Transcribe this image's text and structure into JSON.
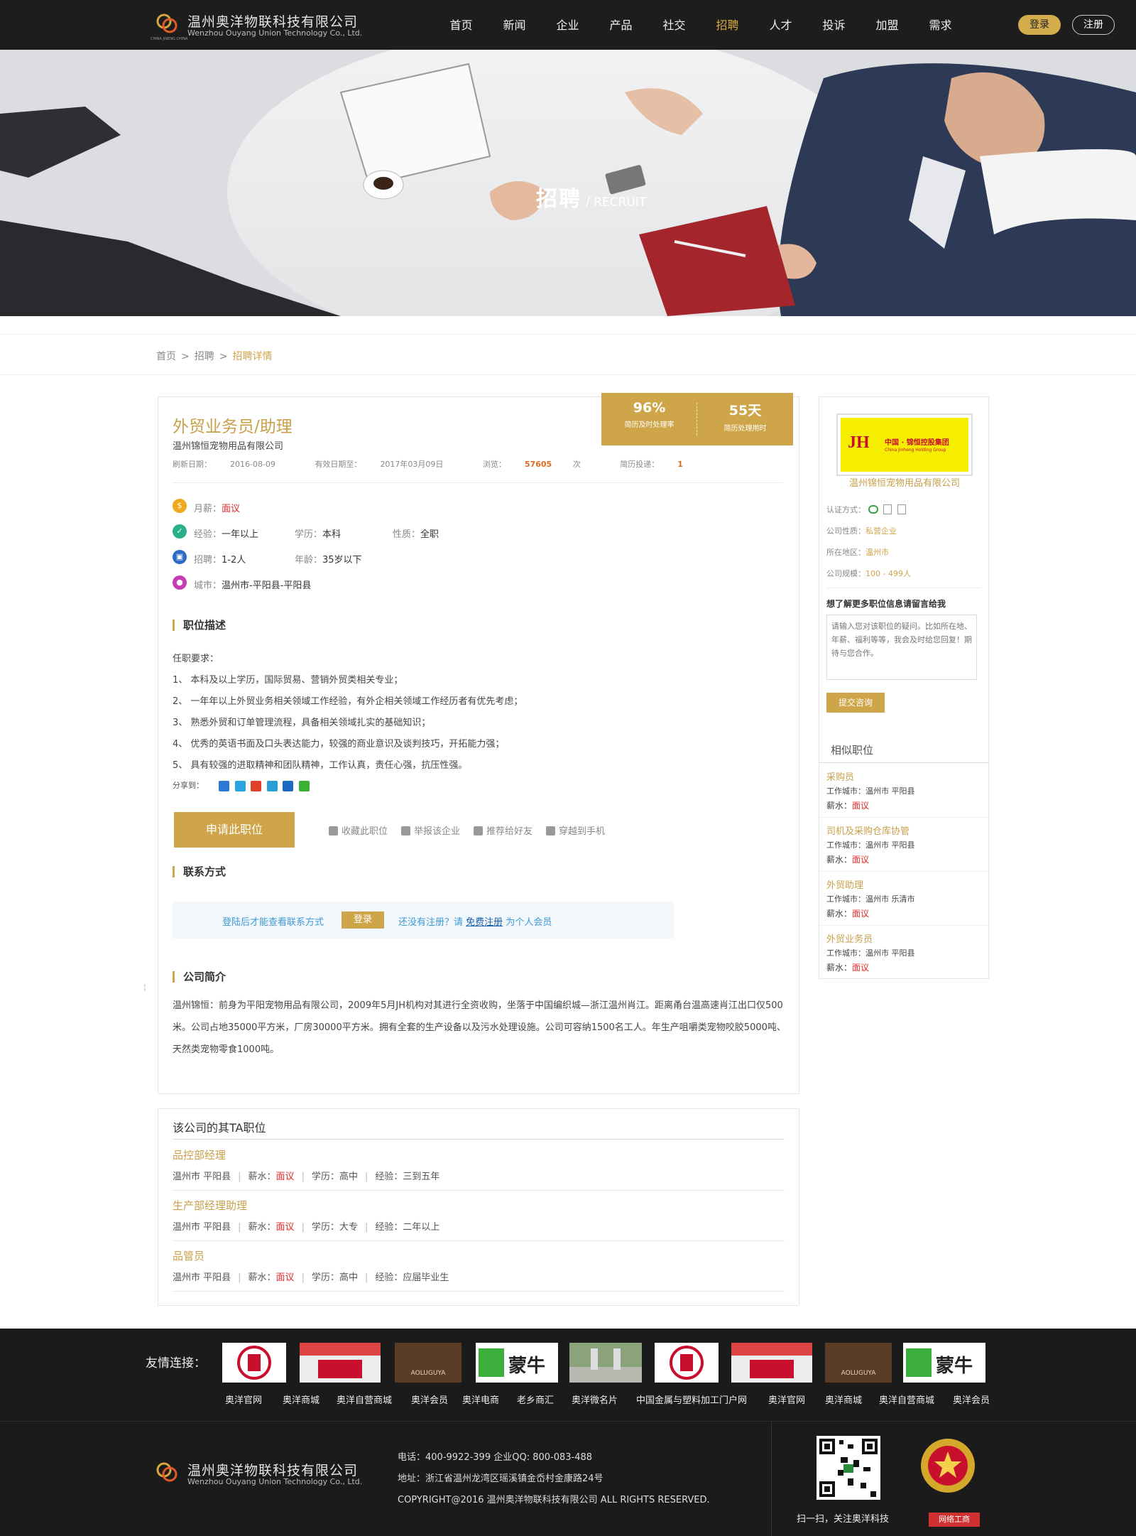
{
  "header": {
    "logo_cn": "温州奥洋物联科技有限公司",
    "logo_en": "Wenzhou Ouyang Union Technology Co., Ltd.",
    "logo_tiny": "CHINA JINENG CHINA",
    "nav": [
      "首页",
      "新闻",
      "企业",
      "产品",
      "社交",
      "招聘",
      "人才",
      "投诉",
      "加盟",
      "需求"
    ],
    "active_nav": "招聘",
    "login": "登录",
    "register": "注册"
  },
  "banner": {
    "title_cn": "招聘",
    "title_en": "/ RECRUIT"
  },
  "breadcrumb": {
    "home": "首页",
    "sep": ">",
    "level2": "招聘",
    "current": "招聘详情"
  },
  "job": {
    "title": "外贸业务员/助理",
    "company": "温州锦恒宠物用品有限公司",
    "refresh_label": "刷新日期：",
    "refresh_date": "2016-08-09",
    "valid_label": "有效日期至：",
    "valid_date": "2017年03月09日",
    "views_label": "浏览：",
    "views": "57605",
    "views_unit": "次",
    "applies_label": "简历投递：",
    "applies": "1",
    "stats": [
      {
        "value": "96%",
        "label": "简历及时处理率"
      },
      {
        "value": "55天",
        "label": "简历处理用时"
      }
    ],
    "salary_label": "月薪：",
    "salary": "面议",
    "exp_label": "经验：",
    "exp": "一年以上",
    "edu_label": "学历：",
    "edu": "本科",
    "type_label": "性质：",
    "type": "全职",
    "hire_label": "招聘：",
    "hire": "1-2人",
    "age_label": "年龄：",
    "age": "35岁以下",
    "city_label": "城市：",
    "city": "温州市-平阳县-平阳县",
    "icons": {
      "salary": "$",
      "exp": "✓",
      "hire": "▣",
      "city": "●"
    },
    "desc_title": "职位描述",
    "desc": [
      "任职要求：",
      "1、  本科及以上学历，国际贸易、营销外贸类相关专业；",
      "2、  一年年以上外贸业务相关领域工作经验，有外企相关领域工作经历者有优先考虑；",
      "3、  熟悉外贸和订单管理流程，具备相关领域扎实的基础知识；",
      "4、  优秀的英语书面及口头表达能力，较强的商业意识及谈判技巧，开拓能力强；",
      "5、  具有较强的进取精神和团队精神，工作认真，责任心强，抗压性强。"
    ],
    "share_label": "分享到：",
    "apply_btn": "申请此职位",
    "actions": [
      "收藏此职位",
      "举报该企业",
      "推荐给好友",
      "穿越到手机"
    ],
    "contact_title": "联系方式",
    "contact_tip": "登陆后才能查看联系方式",
    "contact_login": "登录",
    "contact_no": "还没有注册？请",
    "contact_reg": "免费注册",
    "contact_member": "为个人会员",
    "intro_title": "公司简介",
    "intro": "温州锦恒：前身为平阳宠物用品有限公司，2009年5月JH机构对其进行全资收购，坐落于中国编织城—浙江温州肖江。距离甬台温高速肖江出口仅500米。公司占地35000平方米，厂房30000平方米。拥有全套的生产设备以及污水处理设施。公司可容纳1500名工人。年生产咀嚼类宠物咬胶5000吨、天然类宠物零食1000吨。"
  },
  "other_jobs": {
    "title": "该公司的其TA职位",
    "items": [
      {
        "name": "品控部经理",
        "city": "温州市 平阳县",
        "salary_label": "薪水：",
        "salary": "面议",
        "edu": "学历：高中",
        "exp": "经验：三到五年"
      },
      {
        "name": "生产部经理助理",
        "city": "温州市 平阳县",
        "salary_label": "薪水：",
        "salary": "面议",
        "edu": "学历：大专",
        "exp": "经验：二年以上"
      },
      {
        "name": "品管员",
        "city": "温州市 平阳县",
        "salary_label": "薪水：",
        "salary": "面议",
        "edu": "学历：高中",
        "exp": "经验：应届毕业生"
      }
    ],
    "sep": "|"
  },
  "sidebar": {
    "logo_jh": "JH",
    "logo_text": "中国 · 锦恒控股集团",
    "logo_en": "China Jinheng Holding Group",
    "company": "温州锦恒宠物用品有限公司",
    "cert_label": "认证方式：",
    "nature_label": "公司性质：",
    "nature": "私营企业",
    "region_label": "所在地区：",
    "region": "温州市",
    "scale_label": "公司规模：",
    "scale": "100 - 499人",
    "question": "想了解更多职位信息请留言给我",
    "textarea_placeholder": "请输入您对该职位的疑问。比如所在地、年薪、福利等等，我会及时给您回复！期待与您合作。",
    "submit": "提交咨询",
    "similar_title": "相似职位",
    "similar": [
      {
        "name": "采购员",
        "city": "工作城市：温州市 平阳县",
        "salary_label": "薪水：",
        "salary": "面议"
      },
      {
        "name": "司机及采购仓库协管",
        "city": "工作城市：温州市 平阳县",
        "salary_label": "薪水：",
        "salary": "面议"
      },
      {
        "name": "外贸助理",
        "city": "工作城市：温州市 乐清市",
        "salary_label": "薪水：",
        "salary": "面议"
      },
      {
        "name": "外贸业务员",
        "city": "工作城市：温州市 平阳县",
        "salary_label": "薪水：",
        "salary": "面议"
      }
    ]
  },
  "friend_links": {
    "label": "友情连接：",
    "names": [
      "奥洋官网",
      "奥洋商城",
      "奥洋自营商城",
      "奥洋会员",
      "奥洋电商",
      "老乡商汇",
      "奥洋微名片",
      "中国金属与塑料加工门户网",
      "奥洋官网",
      "奥洋商城",
      "奥洋自营商城",
      "奥洋会员"
    ],
    "logo_texts": {
      "aoluguya": "AOLUGUYA",
      "mengniu": "蒙牛"
    }
  },
  "footer": {
    "logo_cn": "温州奥洋物联科技有限公司",
    "logo_en": "Wenzhou Ouyang Union Technology Co., Ltd.",
    "phone": "电话：400-9922-399   企业QQ: 800-083-488",
    "address": "地址：浙江省温州龙湾区瑶溪镇金岙村金康路24号",
    "copyright": "COPYRIGHT@2016 温州奥洋物联科技有限公司 ALL RIGHTS RESERVED.",
    "qr_caption": "扫一扫，关注奥洋科技",
    "badge": "网络工商"
  },
  "colors": {
    "accent": "#cfa54a",
    "header_bg": "#1d1d1d",
    "price": "#e02b2b",
    "link_blue": "#3d9ad6"
  }
}
